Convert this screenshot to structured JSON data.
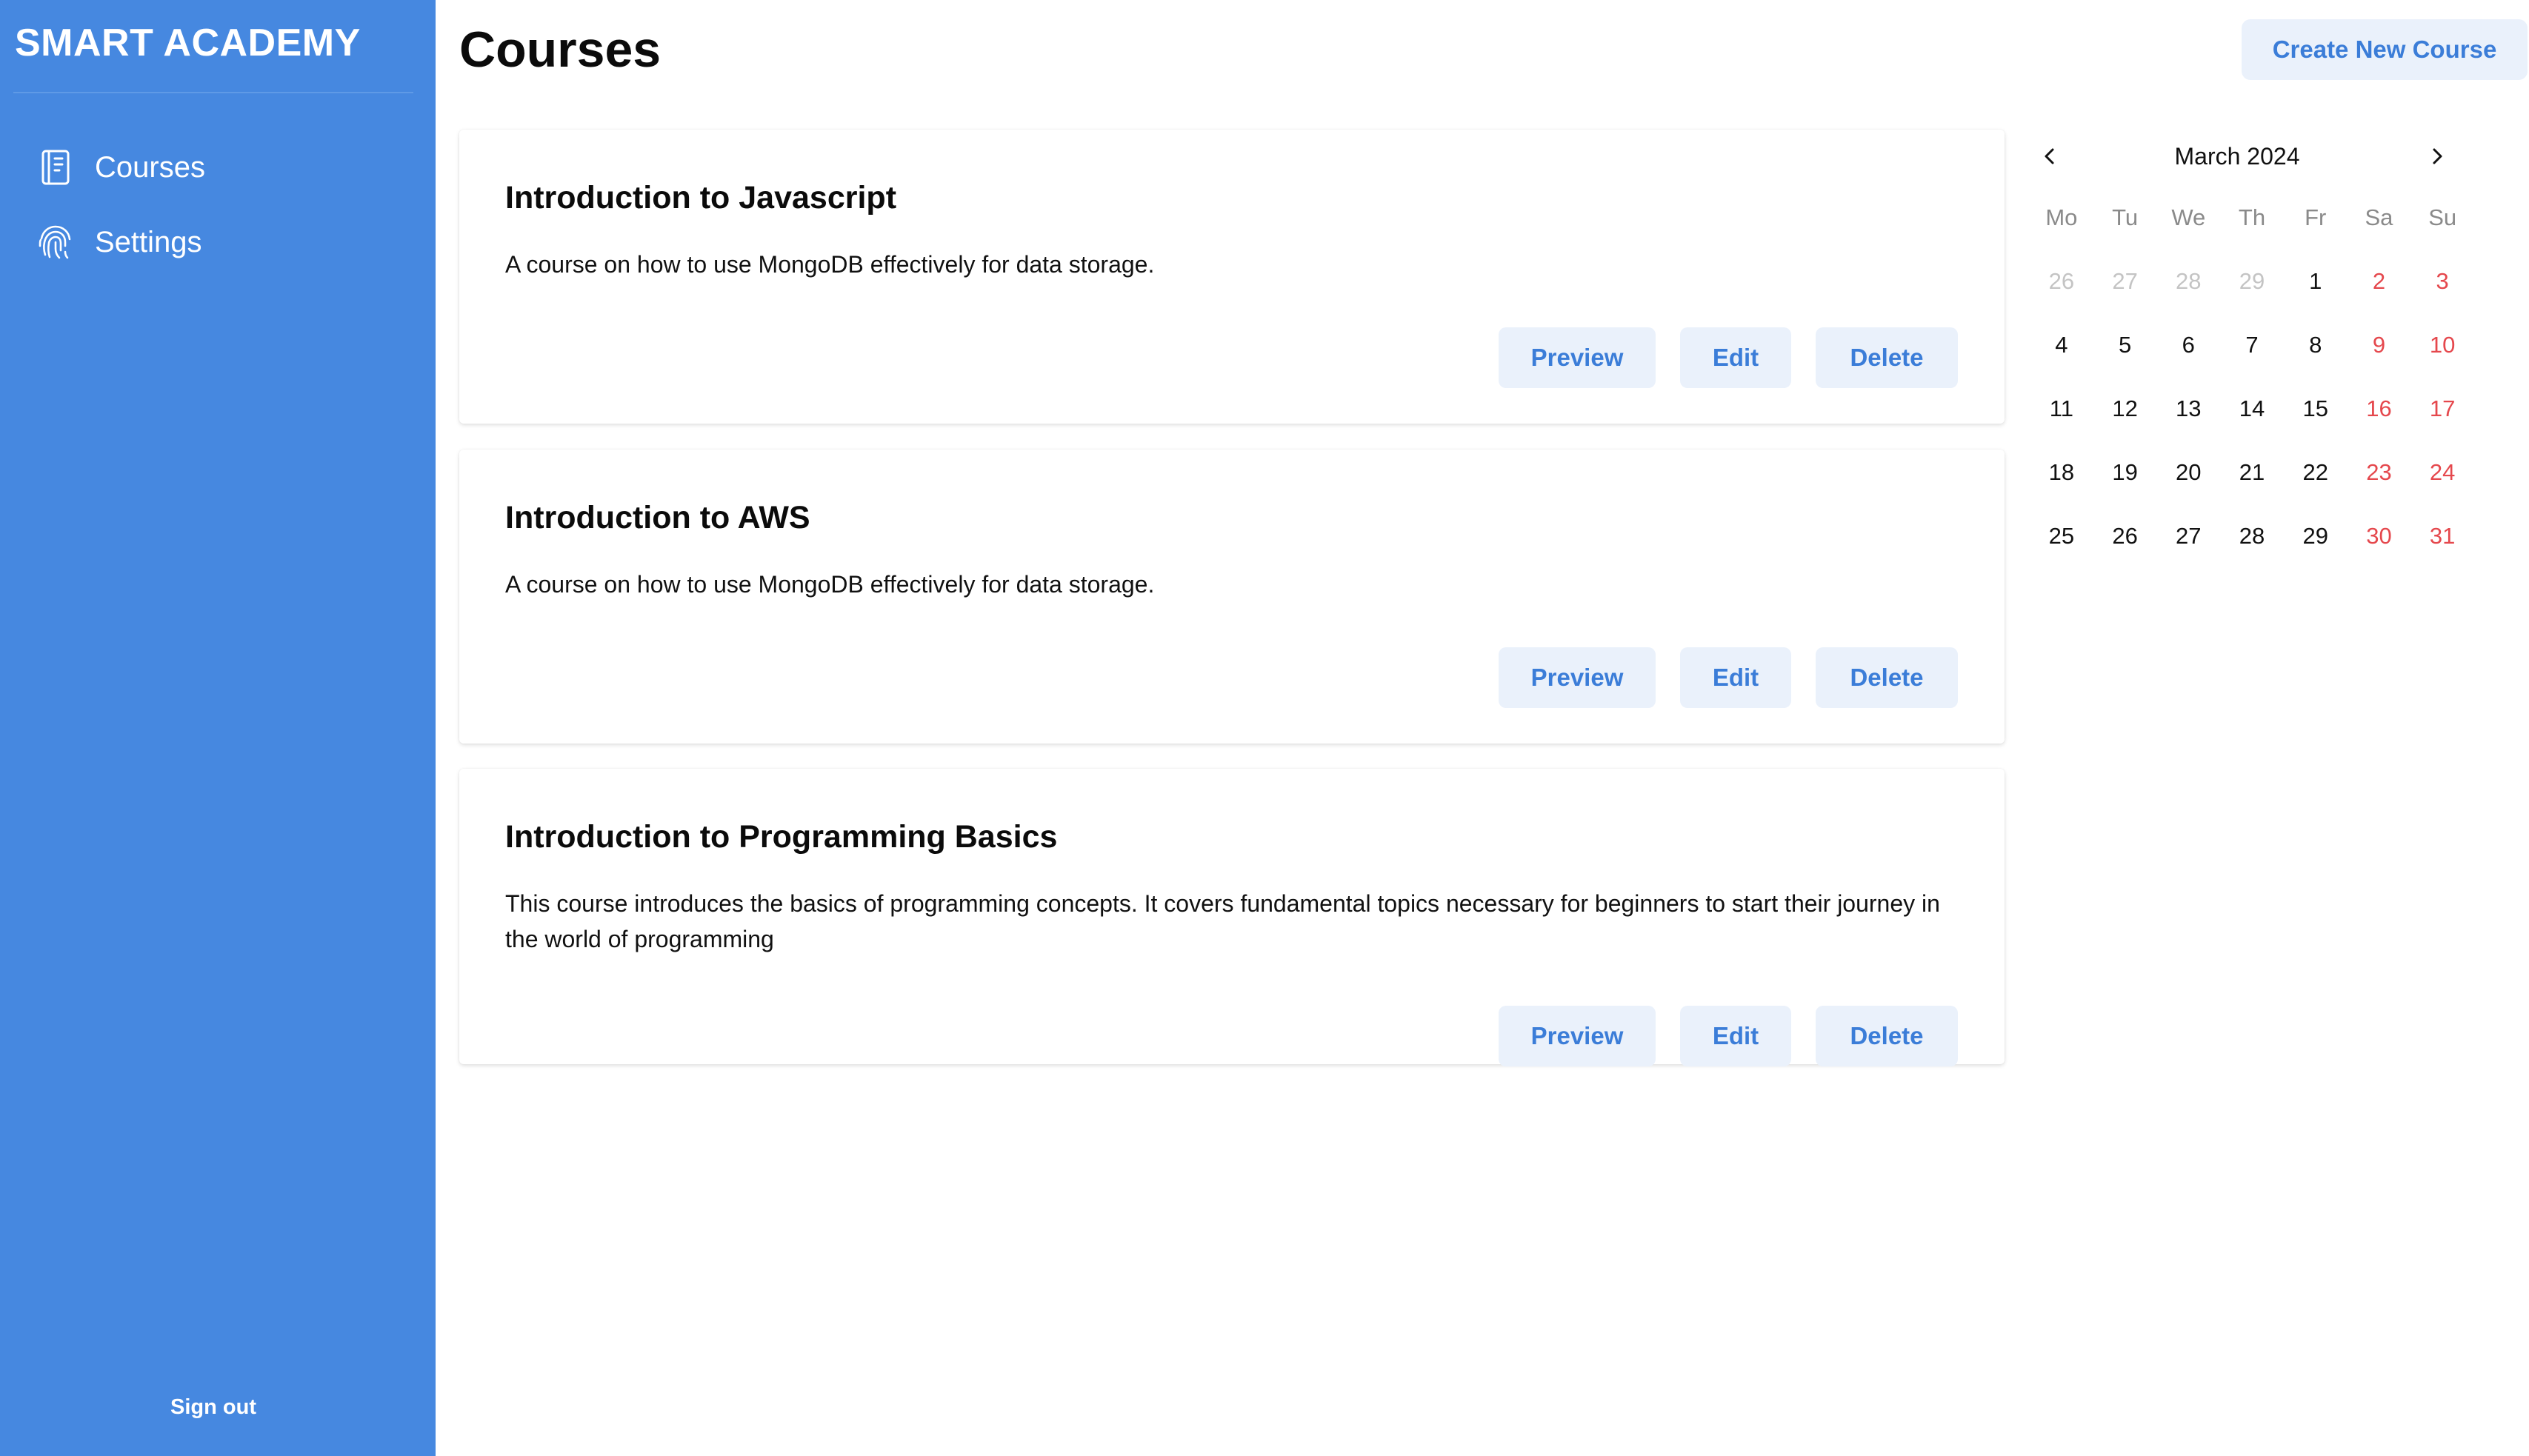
{
  "app": {
    "brand": "SMART ACADEMY"
  },
  "sidebar": {
    "items": [
      {
        "label": "Courses",
        "icon": "book-icon"
      },
      {
        "label": "Settings",
        "icon": "fingerprint-icon"
      }
    ],
    "signout": "Sign out"
  },
  "header": {
    "title": "Courses",
    "create_button": "Create New Course"
  },
  "courses": [
    {
      "title": "Introduction to Javascript",
      "description": "A course on how to use MongoDB effectively for data storage.",
      "actions": {
        "preview": "Preview",
        "edit": "Edit",
        "delete": "Delete"
      }
    },
    {
      "title": "Introduction to AWS",
      "description": "A course on how to use MongoDB effectively for data storage.",
      "actions": {
        "preview": "Preview",
        "edit": "Edit",
        "delete": "Delete"
      }
    },
    {
      "title": "Introduction to Programming Basics",
      "description": "This course introduces the basics of programming concepts. It covers fundamental topics necessary for beginners to start their journey in the world of programming",
      "actions": {
        "preview": "Preview",
        "edit": "Edit",
        "delete": "Delete"
      }
    }
  ],
  "calendar": {
    "month_label": "March 2024",
    "weekdays": [
      "Mo",
      "Tu",
      "We",
      "Th",
      "Fr",
      "Sa",
      "Su"
    ],
    "weeks": [
      [
        "26",
        "27",
        "28",
        "29",
        "1",
        "2",
        "3"
      ],
      [
        "4",
        "5",
        "6",
        "7",
        "8",
        "9",
        "10"
      ],
      [
        "11",
        "12",
        "13",
        "14",
        "15",
        "16",
        "17"
      ],
      [
        "18",
        "19",
        "20",
        "21",
        "22",
        "23",
        "24"
      ],
      [
        "25",
        "26",
        "27",
        "28",
        "29",
        "30",
        "31"
      ]
    ],
    "colors": {
      "weekend": "#e5484d",
      "outside_month": "#c4c4c4"
    }
  },
  "colors": {
    "sidebar": "#4688e0",
    "accent": "#3b7dd8",
    "button_bg": "#eaf1fb"
  }
}
